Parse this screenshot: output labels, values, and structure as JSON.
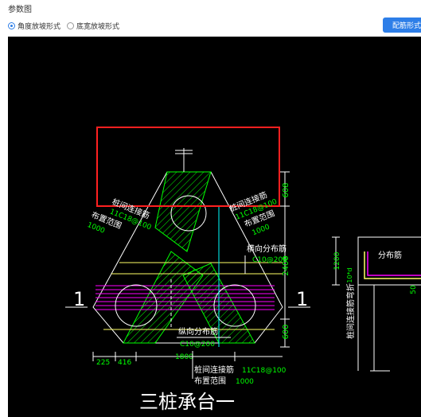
{
  "panel": {
    "title": "参数图"
  },
  "options": [
    {
      "label": "角度放坡形式",
      "selected": true
    },
    {
      "label": "底宽放坡形式",
      "selected": false
    }
  ],
  "config_button": {
    "label": "配筋形式"
  },
  "drawing": {
    "main_title": "三桩承台一",
    "section_mark_left": "1",
    "section_mark_right": "1",
    "left_tie": {
      "label": "桩间连接筋",
      "spec": "11C18@100",
      "range_label": "布置范围",
      "range": "1000"
    },
    "right_tie": {
      "label": "桩间连接筋",
      "spec": "11C18@100",
      "range_label": "布置范围",
      "range": "1000"
    },
    "transverse": {
      "label": "横向分布筋",
      "spec": "C10@200"
    },
    "longitudinal": {
      "label": "纵向分布筋",
      "spec": "C10@200"
    },
    "bottom_tie": {
      "label": "桩间连接筋",
      "spec": "11C18@100",
      "range_label": "布置范围",
      "range": "1000"
    },
    "dims_right": [
      "608",
      "2400",
      "600"
    ],
    "dims_bottom": [
      "225",
      "416",
      "1800"
    ],
    "section": {
      "dist_label": "分布筋",
      "dim_top": "1200",
      "dim_small": "10*d",
      "dim_bottom": "50",
      "vertical_label": "桩间连接筋弯折"
    }
  },
  "colors": {
    "accent": "#2d7ee8",
    "highlight_box": "#ff2020",
    "green": "#00ff00",
    "magenta": "#ff00ff",
    "cyan": "#00ffff",
    "yellow": "#ffff66"
  }
}
